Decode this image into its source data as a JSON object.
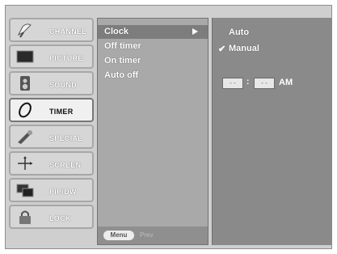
{
  "sidebar": {
    "items": [
      {
        "label": "CHANNEL",
        "icon": "satellite-dish-icon"
      },
      {
        "label": "PICTURE",
        "icon": "tv-screen-icon"
      },
      {
        "label": "SOUND",
        "icon": "speaker-icon"
      },
      {
        "label": "TIMER",
        "icon": "clock-icon"
      },
      {
        "label": "SPECIAL",
        "icon": "tools-icon"
      },
      {
        "label": "SCREEN",
        "icon": "cross-arrows-icon"
      },
      {
        "label": "PIP/DW",
        "icon": "pip-windows-icon"
      },
      {
        "label": "LOCK",
        "icon": "padlock-icon"
      }
    ],
    "active_index": 3
  },
  "menu": {
    "items": [
      {
        "label": "Clock"
      },
      {
        "label": "Off timer"
      },
      {
        "label": "On timer"
      },
      {
        "label": "Auto off"
      }
    ],
    "selected_index": 0
  },
  "footer": {
    "menu_label": "Menu",
    "prev_label": "Prev"
  },
  "submenu": {
    "auto_label": "Auto",
    "manual_label": "Manual",
    "manual_checked": true,
    "hour_value": "- -",
    "minute_value": "- -",
    "separator": ":",
    "ampm": "AM"
  }
}
